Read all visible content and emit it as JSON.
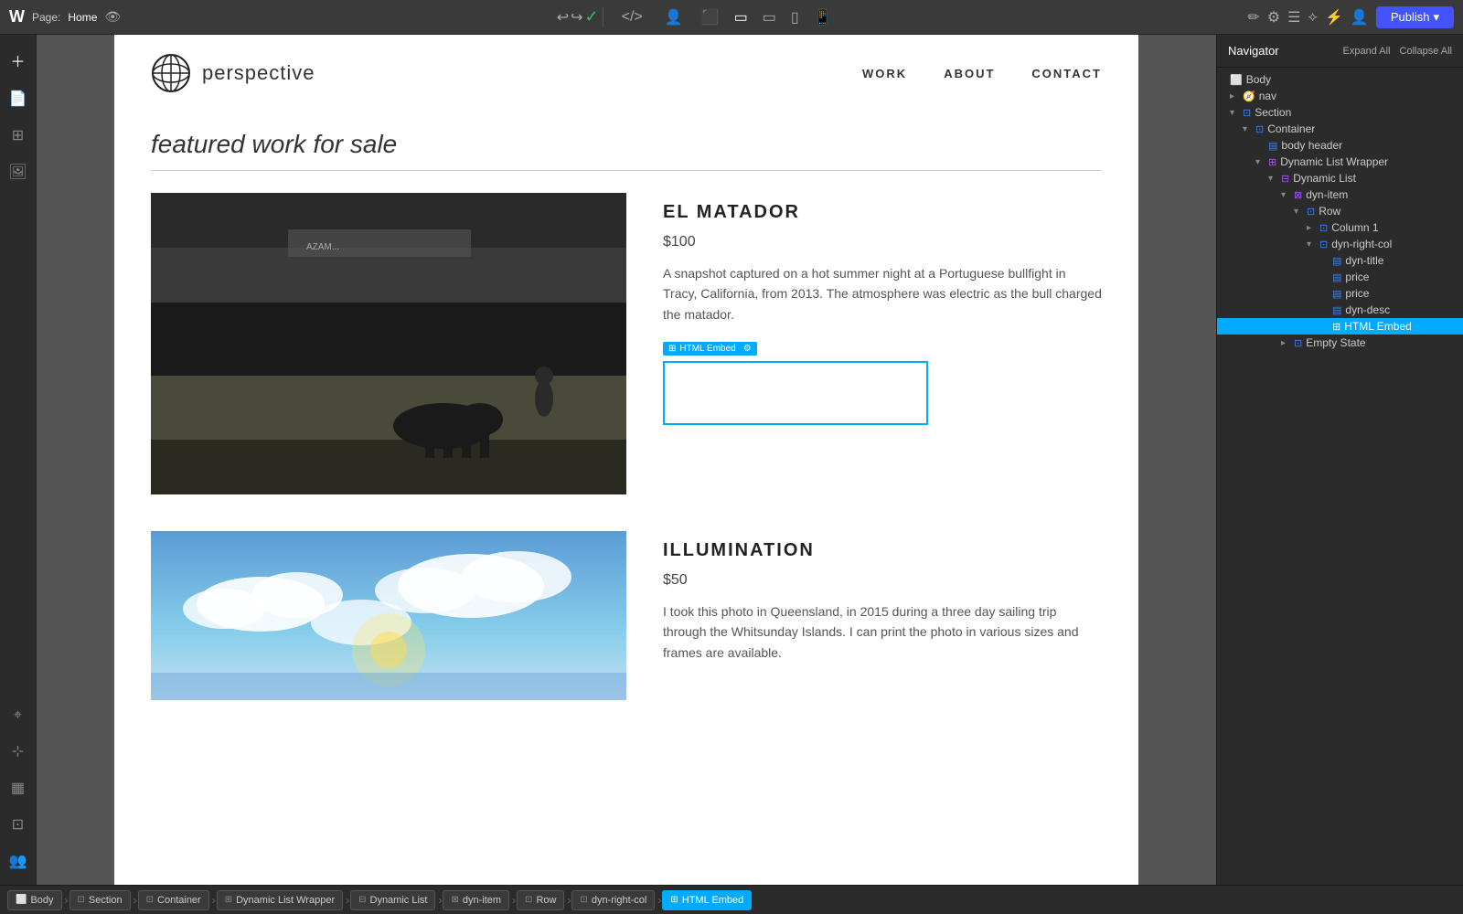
{
  "topbar": {
    "logo": "W",
    "page_prefix": "Page:",
    "page_name": "Home",
    "publish_label": "Publish",
    "devices": [
      "desktop-large",
      "desktop",
      "tablet-landscape",
      "tablet",
      "mobile"
    ]
  },
  "site": {
    "logo_text": "perspective",
    "nav_links": [
      "WORK",
      "ABOUT",
      "CONTACT"
    ],
    "section_title": "featured work for sale"
  },
  "products": [
    {
      "id": "el-matador",
      "title": "EL MATADOR",
      "price": "$100",
      "description": "A snapshot captured on a hot summer night at a Portuguese bullfight in Tracy, California, from 2013. The atmosphere was electric as the bull charged the matador.",
      "has_embed": true,
      "embed_label": "HTML Embed"
    },
    {
      "id": "illumination",
      "title": "ILLUMINATION",
      "price": "$50",
      "description": "I took this photo in Queensland, in 2015 during a three day sailing trip through the Whitsunday Islands. I can print the photo in various sizes and frames are available.",
      "has_embed": false
    }
  ],
  "navigator": {
    "title": "Navigator",
    "expand_all": "Expand All",
    "collapse_all": "Collapse All",
    "tree": [
      {
        "id": "body",
        "label": "Body",
        "indent": 0,
        "type": "body",
        "arrow": "none",
        "expanded": true
      },
      {
        "id": "nav",
        "label": "nav",
        "indent": 1,
        "type": "nav",
        "arrow": "right",
        "expanded": false
      },
      {
        "id": "section",
        "label": "Section",
        "indent": 1,
        "type": "container",
        "arrow": "down",
        "expanded": true
      },
      {
        "id": "container",
        "label": "Container",
        "indent": 2,
        "type": "container",
        "arrow": "down",
        "expanded": true
      },
      {
        "id": "body-header",
        "label": "body header",
        "indent": 3,
        "type": "text",
        "arrow": "none",
        "expanded": false
      },
      {
        "id": "dynamic-list-wrapper",
        "label": "Dynamic List Wrapper",
        "indent": 3,
        "type": "dynwrapper",
        "arrow": "down",
        "expanded": true
      },
      {
        "id": "dynamic-list",
        "label": "Dynamic List",
        "indent": 4,
        "type": "dynlist",
        "arrow": "down",
        "expanded": true
      },
      {
        "id": "dyn-item",
        "label": "dyn-item",
        "indent": 5,
        "type": "dynitem",
        "arrow": "down",
        "expanded": true
      },
      {
        "id": "row",
        "label": "Row",
        "indent": 6,
        "type": "container",
        "arrow": "down",
        "expanded": true
      },
      {
        "id": "column-1",
        "label": "Column 1",
        "indent": 7,
        "type": "container",
        "arrow": "right",
        "expanded": false
      },
      {
        "id": "dyn-right-col",
        "label": "dyn-right-col",
        "indent": 7,
        "type": "container",
        "arrow": "down",
        "expanded": true
      },
      {
        "id": "dyn-title",
        "label": "dyn-title",
        "indent": 8,
        "type": "text",
        "arrow": "none",
        "expanded": false
      },
      {
        "id": "price-1",
        "label": "price",
        "indent": 8,
        "type": "text",
        "arrow": "none",
        "expanded": false
      },
      {
        "id": "price-2",
        "label": "price",
        "indent": 8,
        "type": "text",
        "arrow": "none",
        "expanded": false
      },
      {
        "id": "dyn-desc",
        "label": "dyn-desc",
        "indent": 8,
        "type": "text",
        "arrow": "none",
        "expanded": false
      },
      {
        "id": "html-embed",
        "label": "HTML Embed",
        "indent": 8,
        "type": "htmlembed",
        "arrow": "none",
        "expanded": false,
        "selected": true
      },
      {
        "id": "empty-state",
        "label": "Empty State",
        "indent": 5,
        "type": "container",
        "arrow": "right",
        "expanded": false
      }
    ]
  },
  "breadcrumb": [
    {
      "id": "body",
      "label": "Body",
      "type": "body"
    },
    {
      "id": "section",
      "label": "Section",
      "type": "container"
    },
    {
      "id": "container",
      "label": "Container",
      "type": "container"
    },
    {
      "id": "dynamic-list-wrapper",
      "label": "Dynamic List Wrapper",
      "type": "dynwrapper"
    },
    {
      "id": "dynamic-list",
      "label": "Dynamic List",
      "type": "dynlist"
    },
    {
      "id": "dyn-item",
      "label": "dyn-item",
      "type": "dynitem"
    },
    {
      "id": "row",
      "label": "Row",
      "type": "container"
    },
    {
      "id": "dyn-right-col",
      "label": "dyn-right-col",
      "type": "container"
    },
    {
      "id": "html-embed",
      "label": "HTML Embed",
      "type": "htmlembed",
      "active": true
    }
  ]
}
